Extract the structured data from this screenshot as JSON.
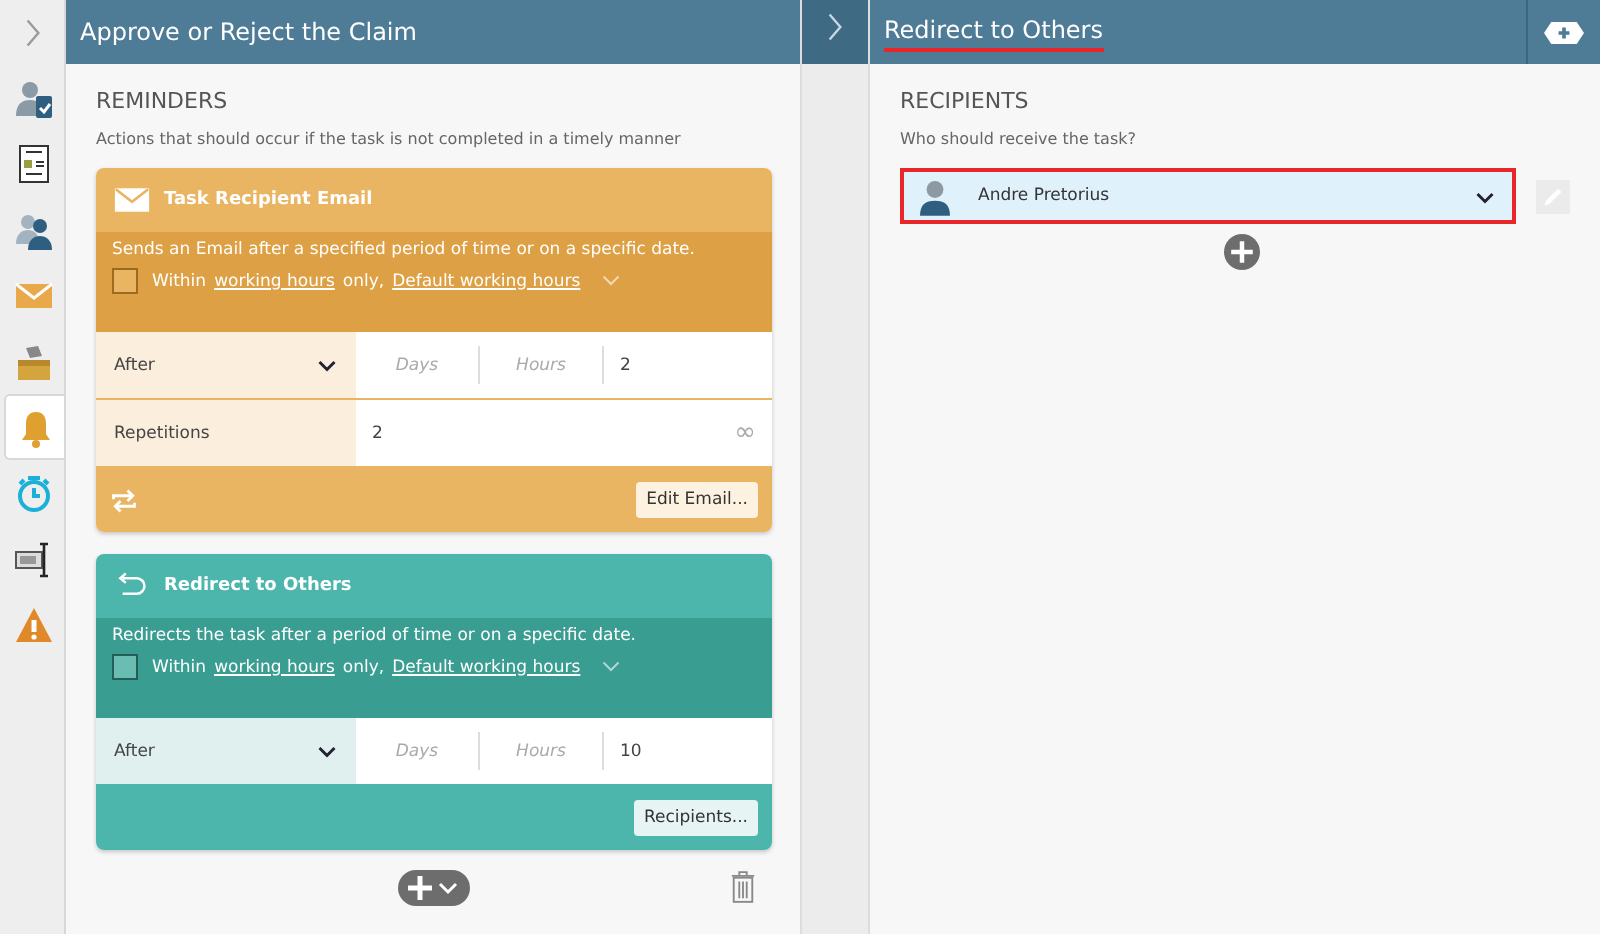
{
  "sidebar": {
    "items": [
      {
        "kind": "assignee",
        "selected": false
      },
      {
        "kind": "form",
        "selected": false
      },
      {
        "kind": "participants",
        "selected": false
      },
      {
        "kind": "email",
        "selected": false
      },
      {
        "kind": "actions",
        "selected": false
      },
      {
        "kind": "reminders",
        "selected": true
      },
      {
        "kind": "deadline",
        "selected": false
      },
      {
        "kind": "fields",
        "selected": false
      },
      {
        "kind": "escalation",
        "selected": false
      }
    ]
  },
  "left_panel": {
    "title": "Approve or Reject the Claim",
    "section": "REMINDERS",
    "description": "Actions that should occur if the task is not completed in a timely manner",
    "reminders": [
      {
        "kind": "email",
        "title": "Task Recipient Email",
        "description": "Sends an Email after a specified period of time or on a specific date.",
        "within_checked": false,
        "within_pre": "Within",
        "within_link": "working hours",
        "within_mid": "only,",
        "within_link2": "Default working hours",
        "after": {
          "label": "After",
          "days_placeholder": "Days",
          "hours_placeholder": "Hours",
          "value": "2"
        },
        "repetitions": {
          "label": "Repetitions",
          "value": "2",
          "infinity": "∞"
        },
        "button": "Edit Email..."
      },
      {
        "kind": "redirect",
        "title": "Redirect to Others",
        "description": "Redirects the task after a period of time or on a specific date.",
        "within_checked": false,
        "within_pre": "Within",
        "within_link": "working hours",
        "within_mid": "only,",
        "within_link2": "Default working hours",
        "after": {
          "label": "After",
          "days_placeholder": "Days",
          "hours_placeholder": "Hours",
          "value": "10"
        },
        "button": "Recipients..."
      }
    ]
  },
  "right_panel": {
    "title": "Redirect to Others",
    "title_underlined": true,
    "section": "RECIPIENTS",
    "question": "Who should receive the task?",
    "recipients": [
      {
        "name": "Andre Pretorius",
        "highlighted": true
      }
    ]
  }
}
